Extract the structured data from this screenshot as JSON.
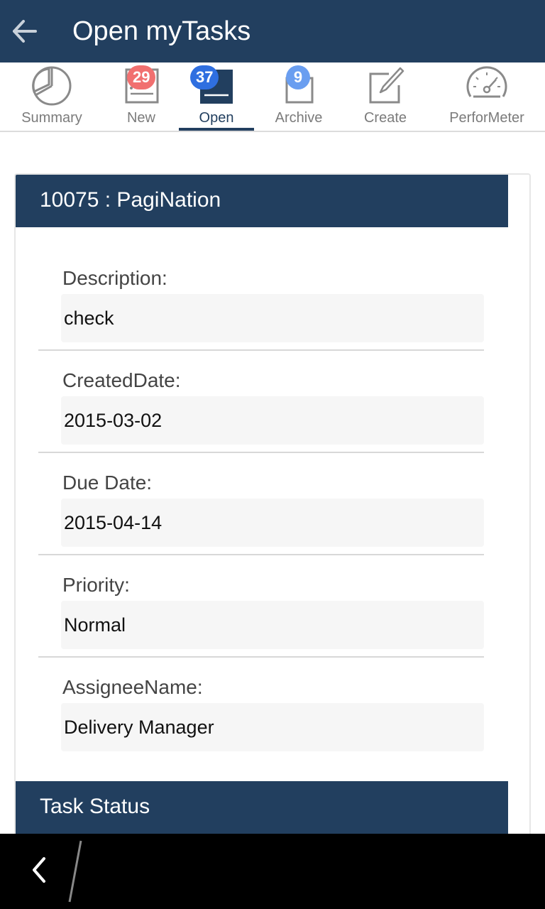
{
  "header": {
    "title": "Open myTasks",
    "back_icon": "arrow-left-icon"
  },
  "colors": {
    "primary": "#223f5f",
    "badge_new": "#f17070",
    "badge_open": "#2f6fe0",
    "badge_archive": "#6a9ef0"
  },
  "tabs": [
    {
      "label": "Summary",
      "icon": "pie-chart-icon"
    },
    {
      "label": "New",
      "icon": "list-icon",
      "badge": "29"
    },
    {
      "label": "Open",
      "icon": "open-list-icon",
      "badge": "37",
      "active": true
    },
    {
      "label": "Archive",
      "icon": "archive-icon",
      "badge": "9"
    },
    {
      "label": "Create",
      "icon": "edit-icon"
    },
    {
      "label": "PerforMeter",
      "icon": "gauge-icon"
    }
  ],
  "task": {
    "header": "10075 : PagiNation",
    "fields": [
      {
        "label": "Description:",
        "value": "check"
      },
      {
        "label": "CreatedDate:",
        "value": "2015-03-02"
      },
      {
        "label": "Due Date:",
        "value": "2015-04-14"
      },
      {
        "label": "Priority:",
        "value": "Normal"
      },
      {
        "label": "AssigneeName:",
        "value": "Delivery Manager"
      }
    ],
    "status_header": "Task Status"
  }
}
